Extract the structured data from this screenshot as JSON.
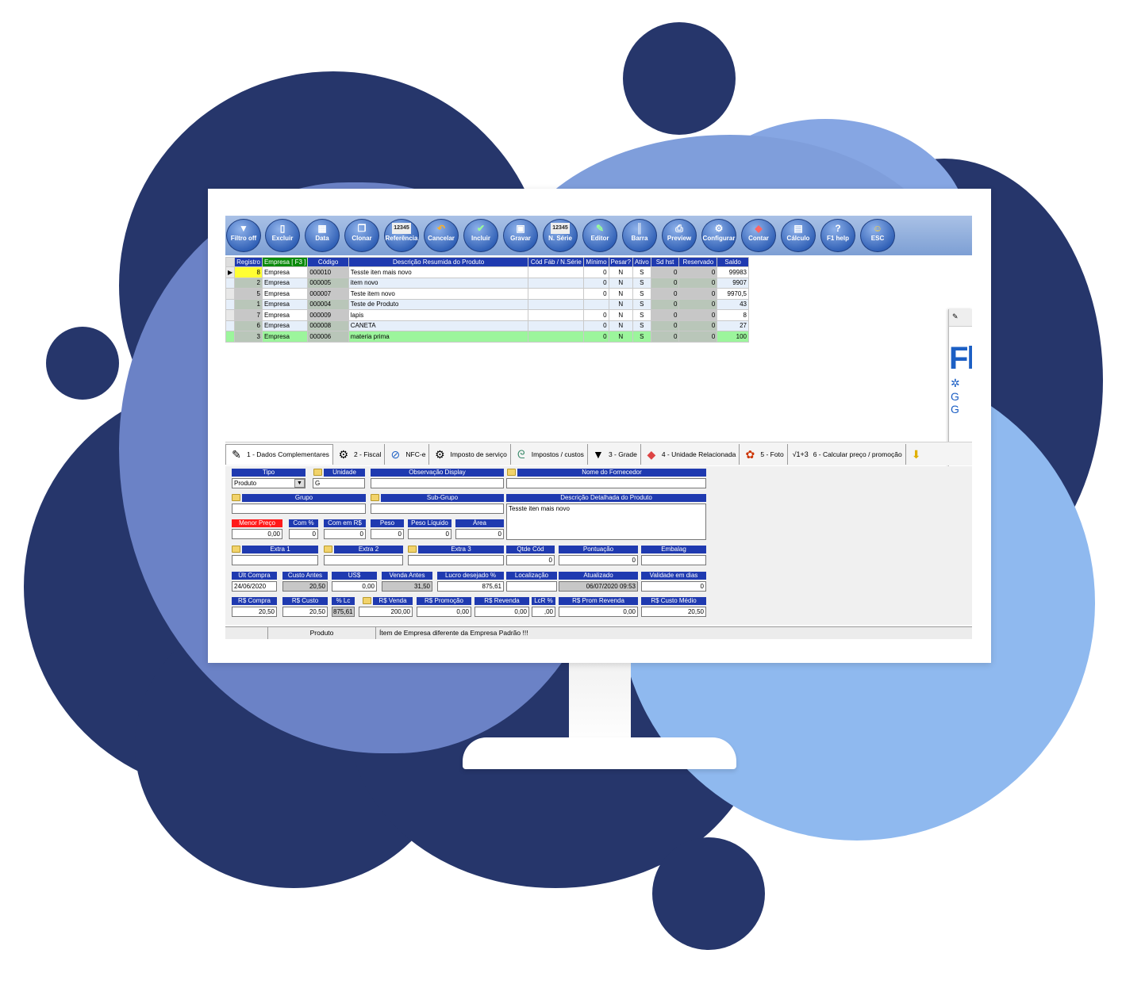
{
  "toolbar": {
    "buttons": [
      {
        "label": "Filtro off",
        "icon": "filter-icon"
      },
      {
        "label": "Excluir",
        "icon": "delete-icon"
      },
      {
        "label": "Data",
        "icon": "calendar-icon"
      },
      {
        "label": "Clonar",
        "icon": "clone-icon"
      },
      {
        "label": "Referência",
        "icon": "reference-icon"
      },
      {
        "label": "Cancelar",
        "icon": "cancel-icon"
      },
      {
        "label": "Incluir",
        "icon": "add-icon"
      },
      {
        "label": "Gravar",
        "icon": "save-icon"
      },
      {
        "label": "N. Série",
        "icon": "serial-icon"
      },
      {
        "label": "Editor",
        "icon": "pencil-icon"
      },
      {
        "label": "Barra",
        "icon": "barcode-icon"
      },
      {
        "label": "Preview",
        "icon": "printer-icon"
      },
      {
        "label": "Configurar",
        "icon": "gear-icon"
      },
      {
        "label": "Contar",
        "icon": "count-icon"
      },
      {
        "label": "Cálculo",
        "icon": "calculator-icon"
      },
      {
        "label": "F1 help",
        "icon": "help-icon"
      },
      {
        "label": "ESC",
        "icon": "exit-icon"
      }
    ],
    "icon_text_ref": "12345",
    "icon_text_serie": "12345"
  },
  "grid": {
    "columns": [
      "Registro",
      "Empresa [ F3 ]",
      "Código",
      "Descrição Resumida do Produto",
      "Cód Fáb / N.Série",
      "Mínimo",
      "Pesar?",
      "Ativo",
      "Sd hst",
      "Reservado",
      "Saldo"
    ],
    "rows": [
      [
        "8",
        "Empresa",
        "000010",
        "Tesste iten mais novo",
        "",
        "0",
        "N",
        "S",
        "0",
        "0",
        "99983"
      ],
      [
        "2",
        "Empresa",
        "000005",
        "item novo",
        "",
        "0",
        "N",
        "S",
        "0",
        "0",
        "9907"
      ],
      [
        "5",
        "Empresa",
        "000007",
        "Teste item novo",
        "",
        "0",
        "N",
        "S",
        "0",
        "0",
        "9970,5"
      ],
      [
        "1",
        "Empresa",
        "000004",
        "Teste de Produto",
        "",
        "",
        "N",
        "S",
        "0",
        "0",
        "43"
      ],
      [
        "7",
        "Empresa",
        "000009",
        "lapis",
        "",
        "0",
        "N",
        "S",
        "0",
        "0",
        "8"
      ],
      [
        "6",
        "Empresa",
        "000008",
        "CANETA",
        "",
        "0",
        "N",
        "S",
        "0",
        "0",
        "27"
      ],
      [
        "3",
        "Empresa",
        "000006",
        "materia prima",
        "",
        "0",
        "N",
        "S",
        "0",
        "0",
        "100"
      ]
    ]
  },
  "tabs": [
    {
      "label": "1 - Dados Complementares",
      "icon": "notepad-icon"
    },
    {
      "label": "2 - Fiscal",
      "icon": "gears-icon"
    },
    {
      "label": "NFC-e",
      "icon": "nfce-icon"
    },
    {
      "label": "Imposto de serviço",
      "icon": "gears-icon"
    },
    {
      "label": "Impostos / custos",
      "icon": "swirl-icon"
    },
    {
      "label": "3 - Grade",
      "icon": "shirt-icon"
    },
    {
      "label": "4 - Unidade Relacionada",
      "icon": "tag-icon"
    },
    {
      "label": "5 - Foto",
      "icon": "photo-icon"
    },
    {
      "label": "6 - Calcular preço / promoção",
      "icon": "sqrt-icon"
    }
  ],
  "sqrt_text": "√1+3",
  "form": {
    "tipo": {
      "label": "Tipo",
      "value": "Produto"
    },
    "unidade": {
      "label": "Unidade",
      "value": "G"
    },
    "obs_display": {
      "label": "Observação Display",
      "value": ""
    },
    "fornecedor": {
      "label": "Nome do Fornecedor",
      "value": ""
    },
    "grupo": {
      "label": "Grupo",
      "value": ""
    },
    "subgrupo": {
      "label": "Sub-Grupo",
      "value": ""
    },
    "desc_detalhada": {
      "label": "Descrição Detalhada do Produto",
      "value": "Tesste iten mais novo"
    },
    "menor_preco": {
      "label": "Menor Preço",
      "value": "0,00"
    },
    "com_pct": {
      "label": "Com %",
      "value": "0"
    },
    "com_rs": {
      "label": "Com em R$",
      "value": "0"
    },
    "peso": {
      "label": "Peso",
      "value": "0"
    },
    "peso_liquido": {
      "label": "Peso Líquido",
      "value": "0"
    },
    "area": {
      "label": "Área",
      "value": "0"
    },
    "extra1": {
      "label": "Extra 1",
      "value": ""
    },
    "extra2": {
      "label": "Extra 2",
      "value": ""
    },
    "extra3": {
      "label": "Extra 3",
      "value": ""
    },
    "qtde_cod": {
      "label": "Qtde Cód",
      "value": "0"
    },
    "pontuacao": {
      "label": "Pontuação",
      "value": "0"
    },
    "embalag": {
      "label": "Embalag",
      "value": ""
    },
    "ult_compra": {
      "label": "Últ Compra",
      "value": "24/06/2020"
    },
    "custo_antes": {
      "label": "Custo Antes",
      "value": "20,50"
    },
    "us": {
      "label": "US$",
      "value": "0,00"
    },
    "venda_antes": {
      "label": "Venda Antes",
      "value": "31,50"
    },
    "lucro": {
      "label": "Lucro desejado %",
      "value": "875,61"
    },
    "localizacao": {
      "label": "Localização",
      "value": ""
    },
    "atualizado": {
      "label": "Atualizado",
      "value": "06/07/2020 09:53"
    },
    "validade": {
      "label": "Validade em dias",
      "value": "0"
    },
    "rs_compra": {
      "label": "R$ Compra",
      "value": "20,50"
    },
    "rs_custo": {
      "label": "R$ Custo",
      "value": "20,50"
    },
    "pct_lc": {
      "label": "% Lc",
      "value": "875,61"
    },
    "rs_venda": {
      "label": "R$ Venda",
      "value": "200,00"
    },
    "rs_promocao": {
      "label": "R$ Promoção",
      "value": "0,00"
    },
    "rs_revenda": {
      "label": "R$ Revenda",
      "value": "0,00"
    },
    "lcr_pct": {
      "label": "LcR %",
      "value": ",00"
    },
    "rs_prom_revenda": {
      "label": "R$ Prom Revenda",
      "value": "0,00"
    },
    "rs_custo_medio": {
      "label": "R$ Custo Médio",
      "value": "20,50"
    }
  },
  "status": {
    "section": "Produto",
    "message": "Ítem de Empresa diferente da Empresa Padrão !!!"
  },
  "side_panel": {
    "logo": "Fl"
  },
  "colors": {
    "dark_blob": "#26366b",
    "mid_blob": "#6e84c9",
    "light_blob": "#8fb9ef",
    "header_blue": "#1f3ab0"
  }
}
